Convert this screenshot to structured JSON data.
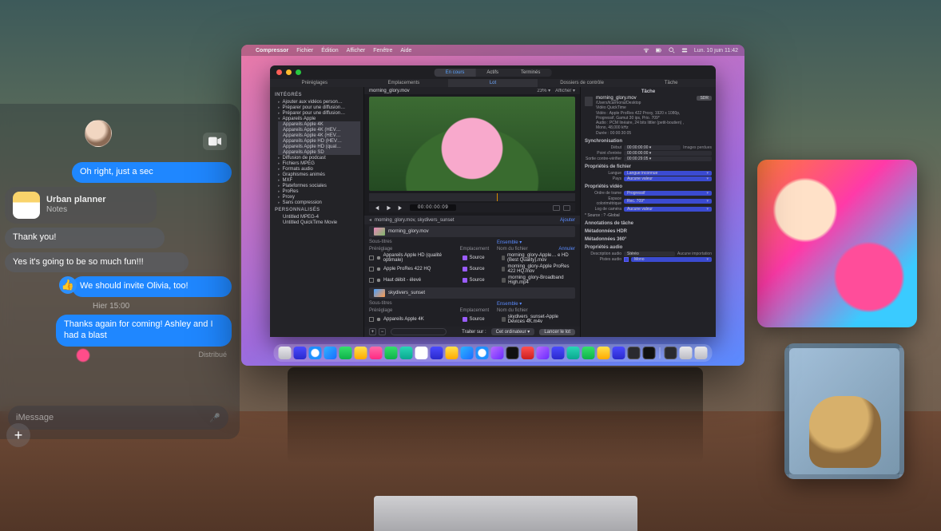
{
  "messages": {
    "video_call_tooltip": "FaceTime",
    "bubble1": "Oh right, just a sec",
    "notes_title": "Urban planner",
    "notes_sub": "Notes",
    "thanks": "Thank you!",
    "yes_fun": "Yes it's going to be so much fun!!!",
    "invite": "We should invite Olivia, too!",
    "timestamp": "Hier 15:00",
    "thanks_again": "Thanks again for coming! Ashley and I had a blast",
    "delivered": "Distribué",
    "compose_placeholder": "iMessage"
  },
  "menubar": {
    "apple": "",
    "app": "Compressor",
    "items": [
      "Fichier",
      "Édition",
      "Afficher",
      "Fenêtre",
      "Aide"
    ],
    "clock": "Lun. 10 juin  11:42"
  },
  "seg_tabs": {
    "a": "En cours",
    "b": "Actifs",
    "c": "Terminés"
  },
  "subseg": {
    "a": "Préréglages",
    "b": "Emplacements",
    "c": "Lot",
    "d": "Dossiers de contrôle",
    "e": "Tâche"
  },
  "sidebar": {
    "h1": "INTÉGRÉS",
    "items1": [
      "Ajouter aux vidéos person…",
      "Préparer pour une diffusion…",
      "Préparer pour une diffusion…",
      "Appareils Apple",
      "Appareils Apple 4K",
      "Appareils Apple 4K (HEV…",
      "Appareils Apple 4K (HEV…",
      "Appareils Apple HD (HEV…",
      "Appareils Apple HD (qual…",
      "Appareils Apple SD",
      "Diffusion de podcast",
      "Fichiers MPEG",
      "Formats audio",
      "Graphismes animés",
      "MXF",
      "Plateformes sociales",
      "ProRes",
      "Proxy",
      "Sans compression"
    ],
    "h2": "PERSONNALISÉS",
    "items2": [
      "Untitled MPEG-4",
      "Untitled QuickTime Movie"
    ]
  },
  "preview": {
    "filename": "morning_glory.mov",
    "zoom": "23% ▾",
    "menu": "Afficher ▾",
    "timecode": "00:00:00:09"
  },
  "batch": {
    "crumb": "morning_glory.mov, skydivers_sunset",
    "add": "Ajouter",
    "clip1": "morning_glory.mov",
    "cols": {
      "a": "Préréglage",
      "b": "Emplacement",
      "c": "Nom du fichier",
      "link": "Annuler",
      "group": "Sous-titres",
      "ens": "Ensemble ▾"
    },
    "rows": [
      {
        "preset": "Appareils Apple HD (qualité optimale)",
        "loc": "Source",
        "out": "morning_glory-Apple… e HD (Best Quality).mov"
      },
      {
        "preset": "Apple ProRes 422 HQ",
        "loc": "Source",
        "out": "morning_glory-Apple ProRes 422 HQ.mov"
      },
      {
        "preset": "Haut débit - élevé",
        "loc": "Source",
        "out": "morning_glory-Broadband High.mp4"
      }
    ],
    "clip2": "skydivers_sunset",
    "rows2": [
      {
        "preset": "Appareils Apple 4K",
        "loc": "Source",
        "out": "skydivers_sunset-Apple Devices 4K.m4v"
      }
    ],
    "footer": {
      "process": "Traiter sur :",
      "where": "Cet ordinateur ▾",
      "go": "Lancer le lot"
    }
  },
  "inspector": {
    "title": "Tâche",
    "file": {
      "name": "morning_glory.mov",
      "path": "/Users/tcarmona/Desktop",
      "kind": "Vidéo QuickTime",
      "video": "Vidéo : Apple ProRes 422 Proxy, 1920 x 1080p, Progressif, Gamut 30 ips, Prio. 709*",
      "audio": "Audio : PCM linéaire, 24 bits littler (petit-boutien) , Mono, 48,000 kHz",
      "dur": "Durée : 00:00:30:05",
      "badge": "SDR"
    },
    "sync": {
      "h": "Synchronisation",
      "start_l": "Début",
      "start_v": "00:00:00:00 ▾",
      "start_t": "Images perdues",
      "ctrl_l": "Point d'entrée",
      "ctrl_v": "00:00:00:00 ▾",
      "out_l": "Sortie contre-vérifier",
      "out_v": "00:00:29:05 ▾"
    },
    "pfile": {
      "h": "Propriétés de fichier",
      "lang_l": "Langue",
      "lang_v": "Langue inconnue",
      "lang_dd": "▾",
      "pays_l": "Pays",
      "pays_v": "Aucune valeur",
      "pays_dd": "▾"
    },
    "pvideo": {
      "h": "Propriétés vidéo",
      "order_l": "Ordre de trame",
      "order_v": "Progressif",
      "dd": "▾",
      "space_l": "Espace colorimétrique",
      "space_v": "Rec. 709*",
      "log_l": "Log de caméra",
      "log_v": "Aucune valeur",
      "src": "* Source : ? -Global"
    },
    "anno": {
      "h": "Annotations de tâche"
    },
    "hdr": {
      "h": "Métadonnées HDR"
    },
    "m360": {
      "h": "Métadonnées 360°"
    },
    "paudio": {
      "h": "Propriétés audio",
      "desc_l": "Description audio",
      "desc_v": "Stéréo",
      "desc_t": "Aucune importation",
      "tracks_l": "Pistes audio",
      "tracks_v": "Mono",
      "tracks_dd": "▾"
    }
  }
}
